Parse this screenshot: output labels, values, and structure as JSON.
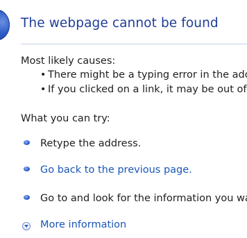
{
  "header": {
    "title": "The webpage cannot be found"
  },
  "causes": {
    "heading": "Most likely causes:",
    "items": [
      "There might be a typing error in the address.",
      "If you clicked on a link, it may be out of date."
    ]
  },
  "try": {
    "heading": "What you can try:",
    "items": [
      {
        "label": "Retype the address.",
        "is_link": false
      },
      {
        "label": "Go back to the previous page.",
        "is_link": true
      },
      {
        "label": "Go to  and look for the information you want.",
        "is_link": false
      }
    ]
  },
  "more_info": {
    "label": "More information"
  },
  "colors": {
    "title": "#1f3d99",
    "link": "#1a56b8",
    "text": "#1e1e1e",
    "divider": "#c5d0e6"
  },
  "icons": {
    "header": "info-icon",
    "list_bullet": "blue-bullet-icon",
    "expand": "chevron-down-circle-icon"
  }
}
